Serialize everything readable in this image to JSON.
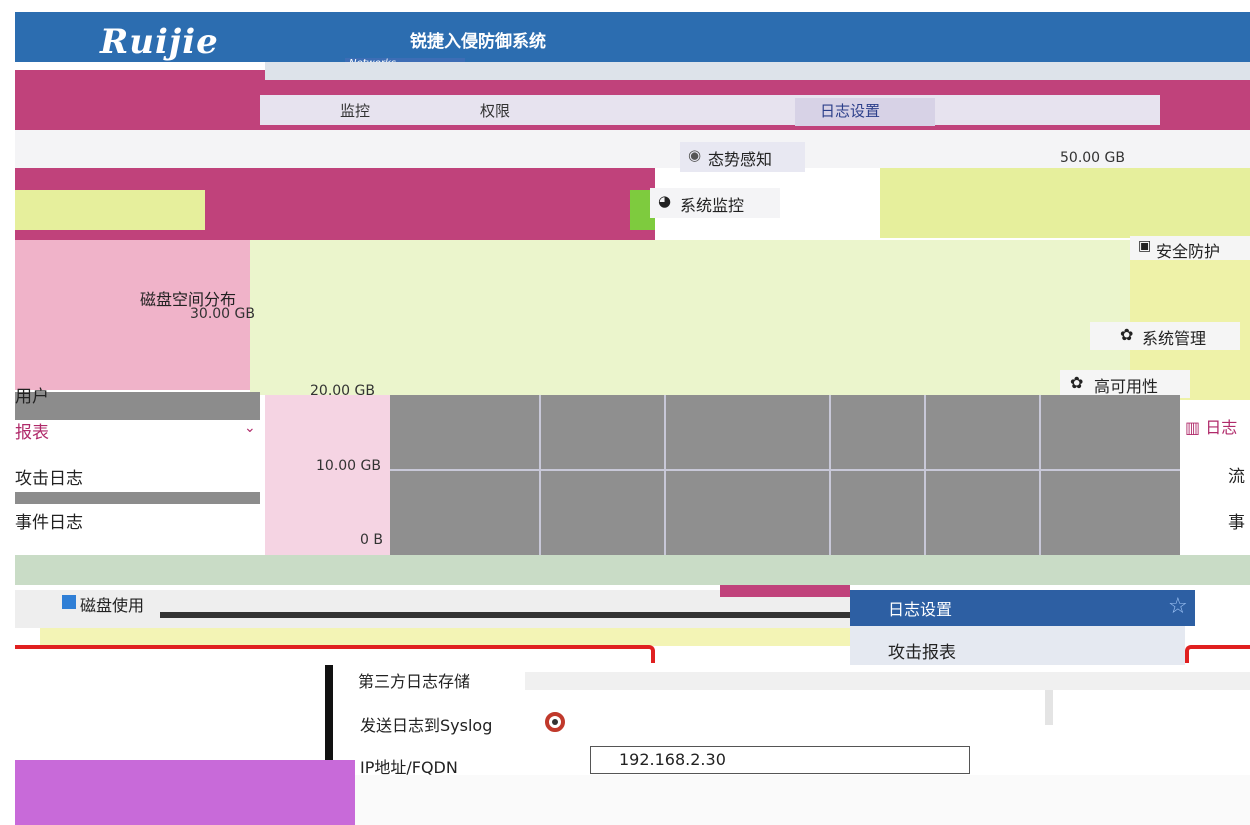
{
  "header": {
    "logo_text": "Ruijie",
    "logo_sub": "Networks",
    "product_title": "锐捷入侵防御系统"
  },
  "top_menu": {
    "items": [
      "监控",
      "权限",
      "日志设置"
    ],
    "active_item": "日志设置"
  },
  "nav": {
    "situation_awareness": "态势感知",
    "system_monitor": "系统监控",
    "security_defense": "安全防护",
    "system_management": "系统管理",
    "high_availability": "高可用性",
    "log_report": "日志"
  },
  "chart": {
    "title": "磁盘空间分布",
    "y_ticks": [
      "30.00 GB",
      "20.00 GB",
      "10.00 GB",
      "0 B"
    ],
    "top_right_value": "50.00 GB",
    "legend": "磁盘使用"
  },
  "left_panel": {
    "items": [
      "用户",
      "报表",
      "攻击日志",
      "事件日志"
    ]
  },
  "right_panel": {
    "items": [
      "流",
      "事"
    ]
  },
  "dropdown": {
    "header": "日志设置",
    "item": "攻击报表"
  },
  "form": {
    "section_title": "第三方日志存储",
    "send_syslog_label": "发送日志到Syslog",
    "ip_label": "IP地址/FQDN",
    "ip_value": "192.168.2.30"
  },
  "colors": {
    "header_blue": "#2c6db0",
    "magenta": "#c0427b",
    "lime": "#ebf5cc",
    "dropdown_blue": "#2d5fa3",
    "accent_red": "#e02020"
  }
}
